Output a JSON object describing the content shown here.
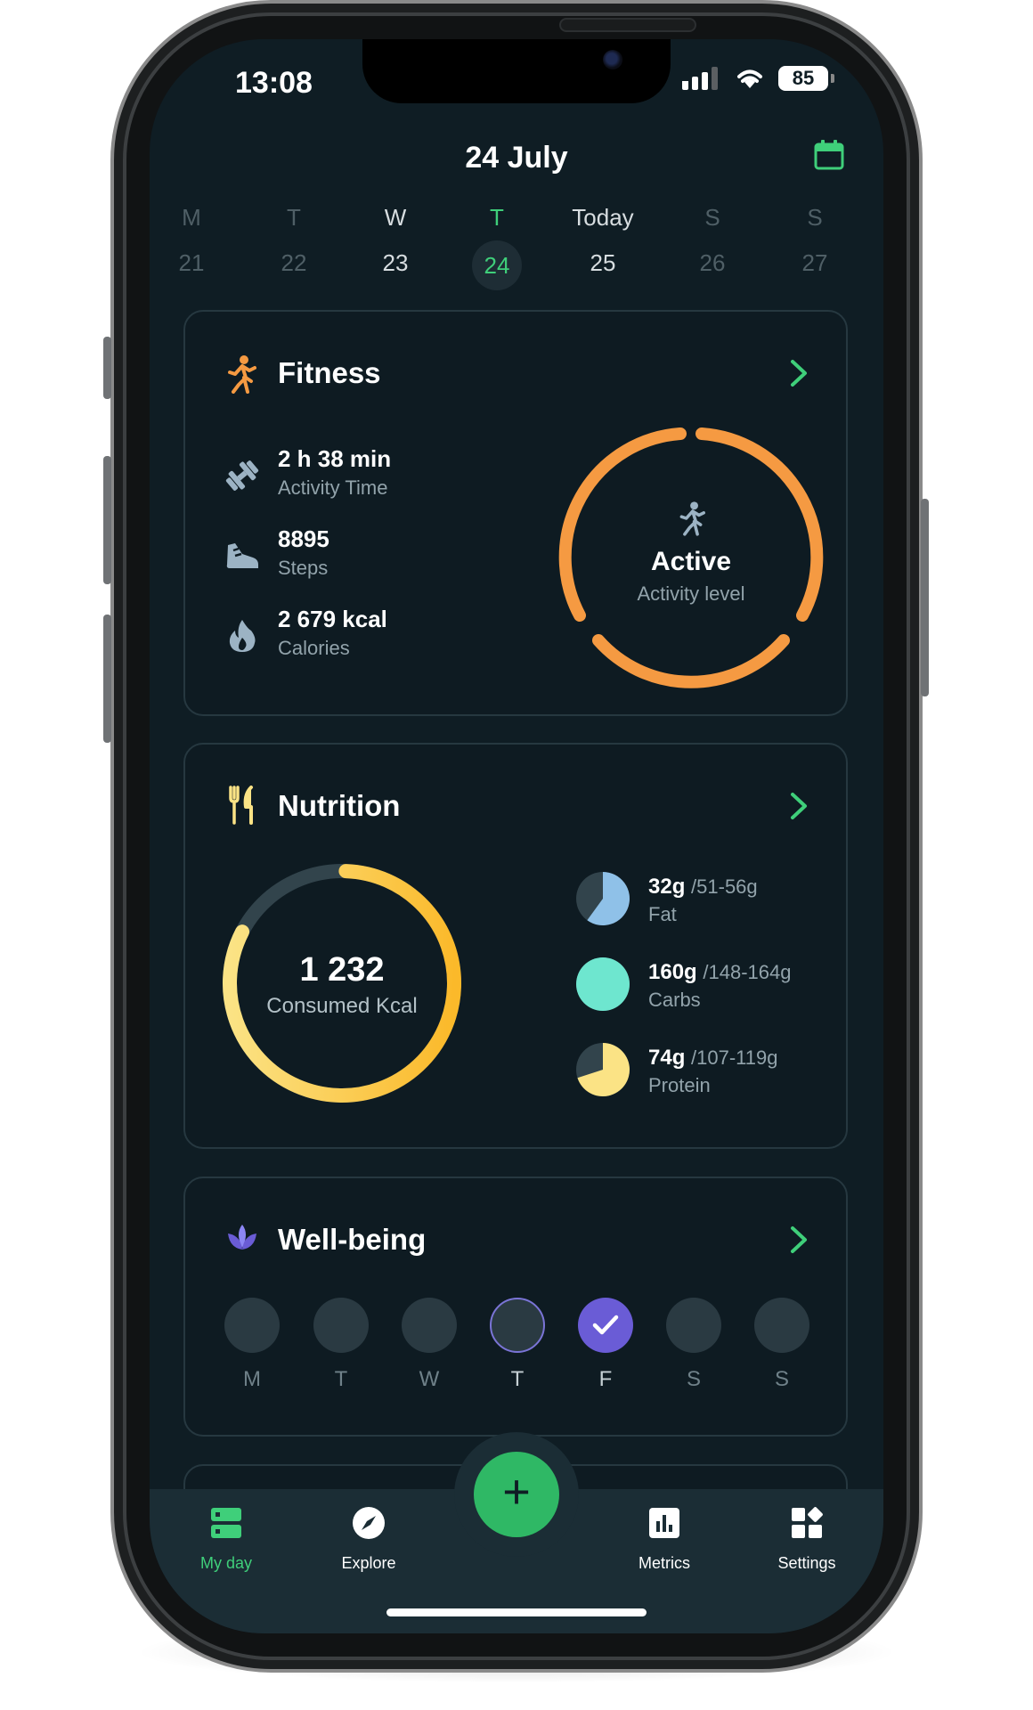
{
  "status_bar": {
    "time": "13:08",
    "battery": "85"
  },
  "header": {
    "date": "24 July"
  },
  "week": [
    {
      "letter": "M",
      "num": "21"
    },
    {
      "letter": "T",
      "num": "22"
    },
    {
      "letter": "W",
      "num": "23"
    },
    {
      "letter": "T",
      "num": "24"
    },
    {
      "letter": "Today",
      "num": "25"
    },
    {
      "letter": "S",
      "num": "26"
    },
    {
      "letter": "S",
      "num": "27"
    }
  ],
  "fitness": {
    "title": "Fitness",
    "stats": [
      {
        "value": "2 h 38 min",
        "label": "Activity Time",
        "icon": "dumbbell-icon"
      },
      {
        "value": "8895",
        "label": "Steps",
        "icon": "shoe-icon"
      },
      {
        "value": "2 679 kcal",
        "label": "Calories",
        "icon": "flame-icon"
      }
    ],
    "ring_title": "Active",
    "ring_label": "Activity level",
    "accent": "#f59a42"
  },
  "nutrition": {
    "title": "Nutrition",
    "consumed": "1 232",
    "consumed_label": "Consumed Kcal",
    "progress": 0.82,
    "macros": [
      {
        "value": "32g",
        "range": "/51-56g",
        "label": "Fat",
        "fraction": 0.6,
        "color": "#8fc1e8"
      },
      {
        "value": "160g",
        "range": "/148-164g",
        "label": "Carbs",
        "fraction": 1.0,
        "color": "#6ee6cf"
      },
      {
        "value": "74g",
        "range": "/107-119g",
        "label": "Protein",
        "fraction": 0.7,
        "color": "#fbe385"
      }
    ]
  },
  "wellbeing": {
    "title": "Well-being",
    "days": [
      {
        "day": "M",
        "state": "empty"
      },
      {
        "day": "T",
        "state": "empty"
      },
      {
        "day": "W",
        "state": "empty"
      },
      {
        "day": "T",
        "state": "outlined"
      },
      {
        "day": "F",
        "state": "checked"
      },
      {
        "day": "S",
        "state": "empty"
      },
      {
        "day": "S",
        "state": "empty"
      }
    ]
  },
  "tabs": [
    {
      "label": "My day",
      "icon": "my-day-icon",
      "active": true
    },
    {
      "label": "Explore",
      "icon": "compass-icon",
      "active": false
    },
    {
      "label": "Metrics",
      "icon": "bar-chart-icon",
      "active": false
    },
    {
      "label": "Settings",
      "icon": "widgets-icon",
      "active": false
    }
  ],
  "colors": {
    "accent_green": "#3fcf7a",
    "orange": "#f59a42",
    "yellow": "#fbc02d",
    "purple": "#6a5cd6"
  }
}
